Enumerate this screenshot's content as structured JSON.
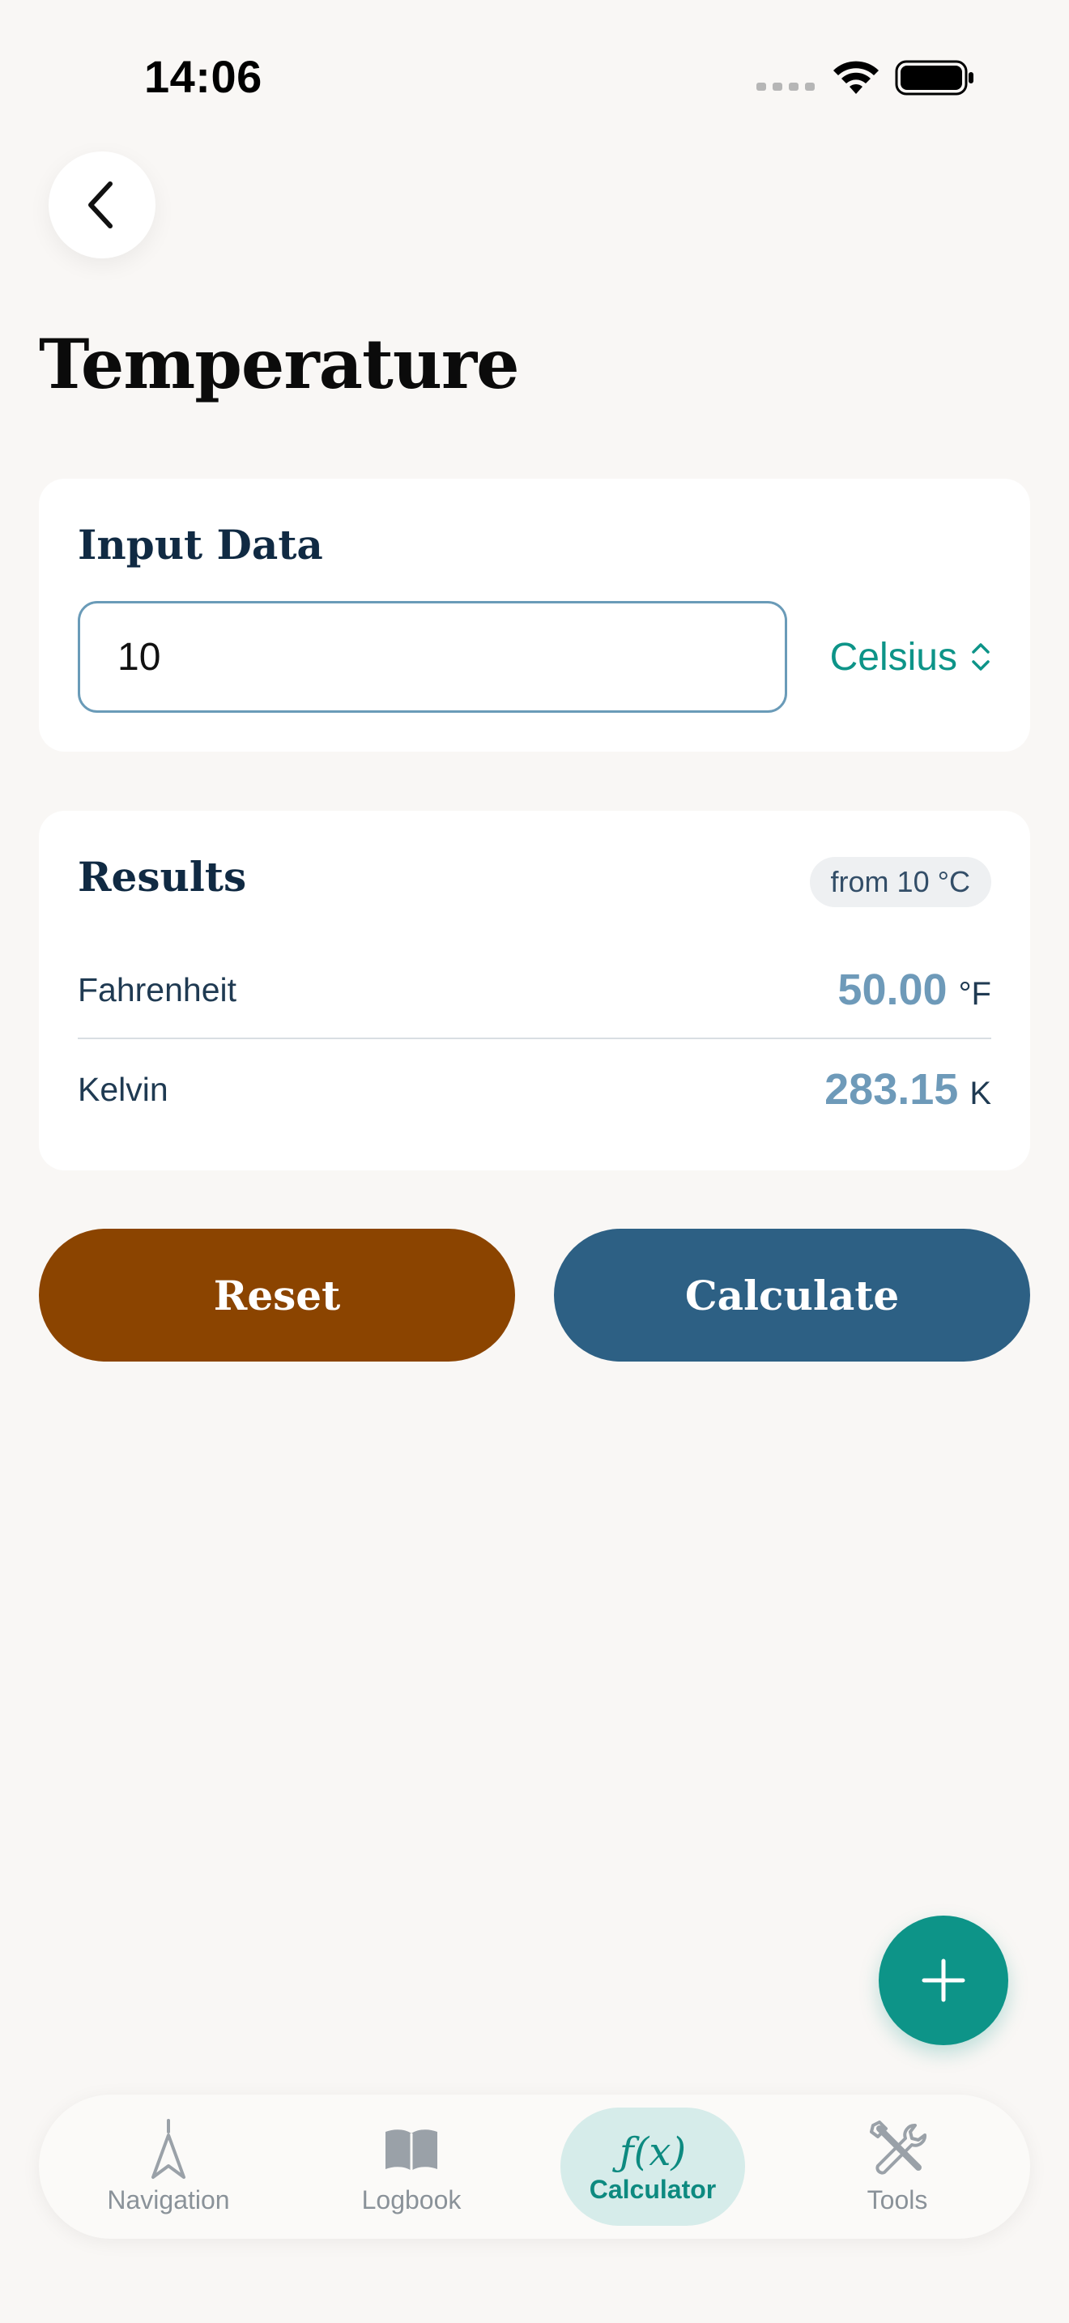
{
  "status": {
    "time": "14:06"
  },
  "page": {
    "title": "Temperature"
  },
  "input_card": {
    "heading": "Input Data",
    "value": "10",
    "unit": "Celsius"
  },
  "results_card": {
    "heading": "Results",
    "badge": "from 10 °C",
    "rows": [
      {
        "label": "Fahrenheit",
        "value": "50.00",
        "unit": "°F"
      },
      {
        "label": "Kelvin",
        "value": "283.15",
        "unit": "K"
      }
    ]
  },
  "actions": {
    "reset_label": "Reset",
    "calculate_label": "Calculate"
  },
  "tabbar": {
    "tabs": [
      {
        "label": "Navigation",
        "icon": "navigation-icon"
      },
      {
        "label": "Logbook",
        "icon": "book-icon"
      },
      {
        "label": "Calculator",
        "icon": "function-icon",
        "icon_text": "ƒ(x)",
        "active": true
      },
      {
        "label": "Tools",
        "icon": "tools-icon"
      }
    ]
  },
  "colors": {
    "background": "#f9f7f5",
    "accent_teal": "#0d9488",
    "reset_button": "#8b4400",
    "calculate_button": "#2d6084",
    "result_value": "#6e9ab9"
  }
}
